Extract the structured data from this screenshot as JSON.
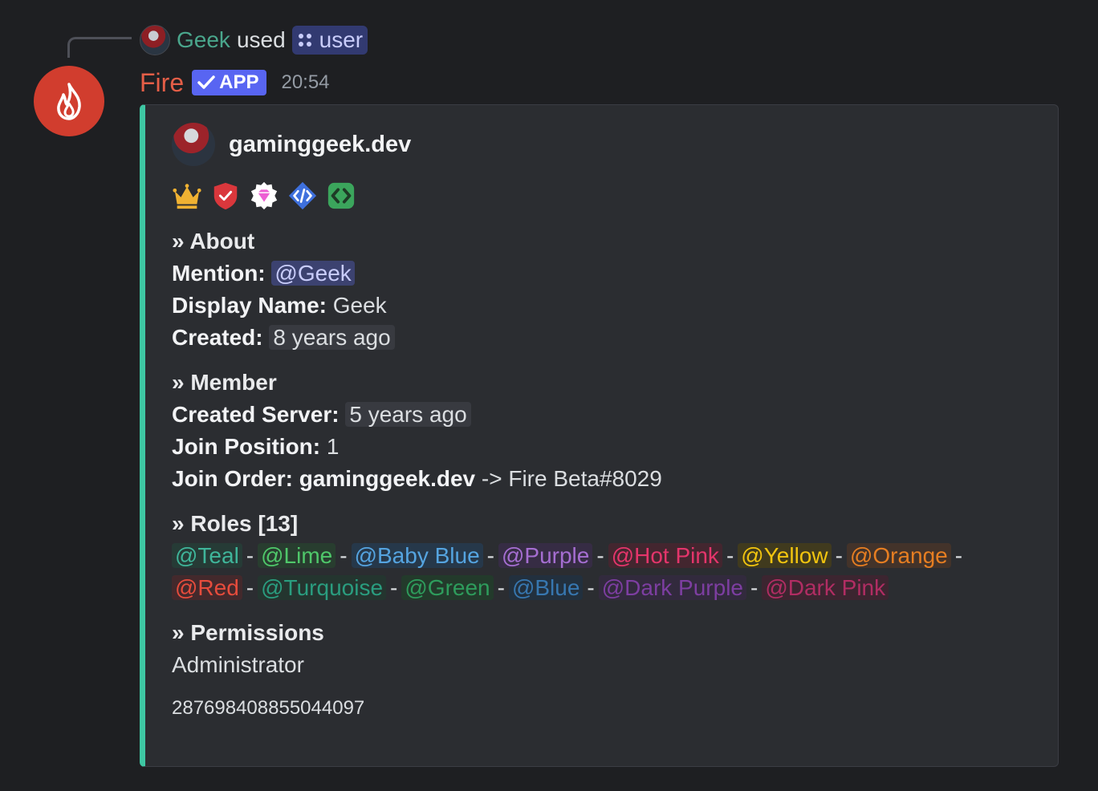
{
  "reply": {
    "user": "Geek",
    "used_text": "used",
    "command": "user",
    "command_icon": "apps-icon"
  },
  "message": {
    "bot_name": "Fire",
    "bot_color": "#e45e47",
    "app_tag": "APP",
    "timestamp": "20:54"
  },
  "embed": {
    "accent": "#3ec7a3",
    "author": "gaminggeek.dev",
    "badges": [
      "crown-icon",
      "shield-check-icon",
      "gem-icon",
      "code-icon",
      "brackets-icon"
    ],
    "about": {
      "title": "» About",
      "mention_label": "Mention:",
      "mention_value": "@Geek",
      "display_label": "Display Name:",
      "display_value": "Geek",
      "created_label": "Created:",
      "created_value": "8 years ago"
    },
    "member": {
      "title": "» Member",
      "created_label": "Created Server:",
      "created_value": "5 years ago",
      "join_pos_label": "Join Position:",
      "join_pos_value": "1",
      "join_order_label": "Join Order:",
      "join_order_user": "gaminggeek.dev",
      "join_order_rest": "-> Fire Beta#8029"
    },
    "roles": {
      "title": "» Roles [13]",
      "separator": "-",
      "items": [
        {
          "name": "@Teal",
          "color": "#3fb59a",
          "bg": "#263b36"
        },
        {
          "name": "@Lime",
          "color": "#4fc76a",
          "bg": "#283d2f"
        },
        {
          "name": "@Baby Blue",
          "color": "#55a4e0",
          "bg": "#26384a"
        },
        {
          "name": "@Purple",
          "color": "#a56ed1",
          "bg": "#362c44"
        },
        {
          "name": "@Hot Pink",
          "color": "#e4356b",
          "bg": "#43262f"
        },
        {
          "name": "@Yellow",
          "color": "#f1c40f",
          "bg": "#403a1e"
        },
        {
          "name": "@Orange",
          "color": "#e67e22",
          "bg": "#43332a"
        },
        {
          "name": "@Red",
          "color": "#e74c3c",
          "bg": "#43292c"
        },
        {
          "name": "@Turquoise",
          "color": "#2a9d7f",
          "bg": "#24352f"
        },
        {
          "name": "@Green",
          "color": "#2e9c5c",
          "bg": "#233a2b"
        },
        {
          "name": "@Blue",
          "color": "#3777b0",
          "bg": "#22303e"
        },
        {
          "name": "@Dark Purple",
          "color": "#7d3ea1",
          "bg": "#322a3d"
        },
        {
          "name": "@Dark Pink",
          "color": "#b12d63",
          "bg": "#3c2530"
        }
      ]
    },
    "permissions": {
      "title": "» Permissions",
      "value": "Administrator"
    },
    "footer": "287698408855044097"
  }
}
